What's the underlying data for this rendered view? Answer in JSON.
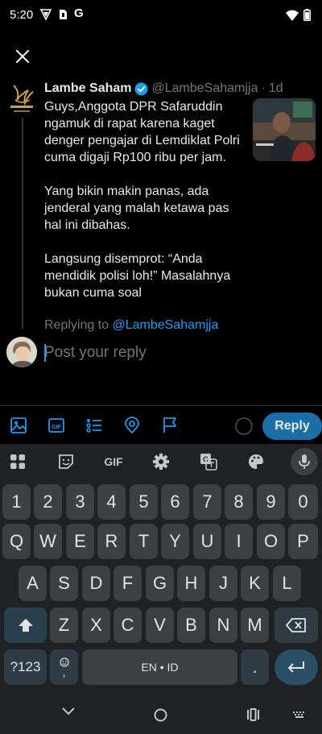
{
  "status_bar": {
    "time": "5:20",
    "extra_icon": "G"
  },
  "tweet": {
    "author_name": "Lambe Saham",
    "handle": "@LambeSahamjja",
    "separator": "·",
    "time_ago": "1d",
    "paragraphs": [
      "Guys,Anggota DPR Safaruddin ngamuk di rapat karena kaget denger pengajar di Lemdiklat Polri cuma digaji Rp100 ribu per jam.",
      "Yang bikin makin panas, ada jenderal yang malah ketawa pas hal ini dibahas.",
      "Langsung disemprot: “Anda mendidik polisi loh!” Masalahnya bukan cuma soal"
    ]
  },
  "replying": {
    "prefix": "Replying to",
    "mention": "@LambeSahamjja"
  },
  "compose": {
    "placeholder": "Post your reply",
    "reply_button": "Reply"
  },
  "keyboard": {
    "gif_label": "GIF",
    "number_row": [
      "1",
      "2",
      "3",
      "4",
      "5",
      "6",
      "7",
      "8",
      "9",
      "0"
    ],
    "row1": [
      "Q",
      "W",
      "E",
      "R",
      "T",
      "Y",
      "U",
      "I",
      "O",
      "P"
    ],
    "row2": [
      "A",
      "S",
      "D",
      "F",
      "G",
      "H",
      "J",
      "K",
      "L"
    ],
    "row3": [
      "Z",
      "X",
      "C",
      "V",
      "B",
      "N",
      "M"
    ],
    "symbols_key": "?123",
    "comma_key": ",",
    "space_label": "EN • ID",
    "period_key": "."
  },
  "colors": {
    "accent": "#1d9bf0",
    "reply_button": "#1a6fa6",
    "verified": "#1d9bf0"
  }
}
